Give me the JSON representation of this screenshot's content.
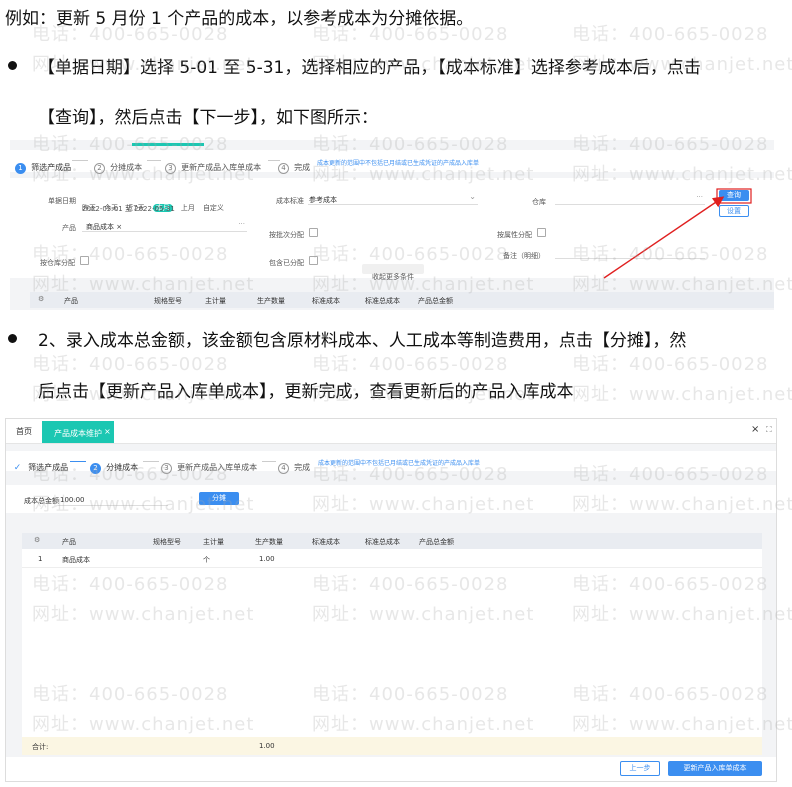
{
  "doc": {
    "line1": "例如：更新 5 月份 1 个产品的成本，以参考成本为分摊依据。",
    "bullet1_a": "【单据日期】选择 5-01 至 5-31，选择相应的产品，【成本标准】选择参考成本后，点击",
    "bullet1_b": "【查询】，然后点击【下一步】，如下图所示：",
    "bullet2_a": "2、录入成本总金额，该金额包含原材料成本、人工成本等制造费用，点击【分摊】，然",
    "bullet2_b": "后点击【更新产品入库单成本】，更新完成，查看更新后的产品入库成本"
  },
  "watermark": {
    "phone": "电话：400-665-0028",
    "site": "网址：www.chanjet.net"
  },
  "shot1": {
    "steps": [
      {
        "num": "1",
        "label": "筛选产成品"
      },
      {
        "num": "2",
        "label": "分摊成本"
      },
      {
        "num": "3",
        "label": "更新产成品入库单成本"
      },
      {
        "num": "4",
        "label": "完成"
      }
    ],
    "hint": "成本更新的范围中不包括已月结或已生成凭证的产成品入库单",
    "date_label": "单据日期",
    "date_opts": [
      "昨天",
      "今天",
      "近7天",
      "本月",
      "上月",
      "自定义"
    ],
    "date_range": "2022-05-01 至 2022-05-31",
    "std_label": "成本标准",
    "std_value": "参考成本",
    "warehouse_label": "仓库",
    "query_btn": "查询",
    "settings_btn": "设置",
    "product_label": "产品",
    "product_tag": "商品成本",
    "batch_label": "按批次分配",
    "attr_label": "按属性分配",
    "pos_label": "按仓库分配",
    "contain_label": "包含已分配",
    "remark_label": "备注（明细）",
    "collapse": "收起更多条件",
    "cols": [
      "产品",
      "规格型号",
      "主计量",
      "生产数量",
      "标准成本",
      "标准总成本",
      "产品总金额"
    ]
  },
  "shot2": {
    "tab_home": "首页",
    "tab_active": "产品成本维护",
    "tab_close": "×",
    "steps": [
      {
        "num": "✓",
        "label": "筛选产成品"
      },
      {
        "num": "2",
        "label": "分摊成本"
      },
      {
        "num": "3",
        "label": "更新产成品入库单成本"
      },
      {
        "num": "4",
        "label": "完成"
      }
    ],
    "hint": "成本更新的范围中不包括已月结或已生成凭证的产成品入库单",
    "total_label": "成本总金额",
    "total_value": "100.00",
    "allocate_btn": "分摊",
    "cols": [
      "产品",
      "规格型号",
      "主计量",
      "生产数量",
      "标准成本",
      "标准总成本",
      "产品总金额"
    ],
    "row": {
      "idx": "1",
      "product": "商品成本",
      "unit": "个",
      "qty": "1.00"
    },
    "sum_label": "合计:",
    "sum_qty": "1.00",
    "prev_btn": "上一步",
    "update_btn": "更新产品入库单成本",
    "win_close": "×",
    "win_max": "⛶"
  },
  "colors": {
    "accent": "#3b8ef0",
    "teal": "#1bc7b2",
    "arrow": "#e02020"
  }
}
